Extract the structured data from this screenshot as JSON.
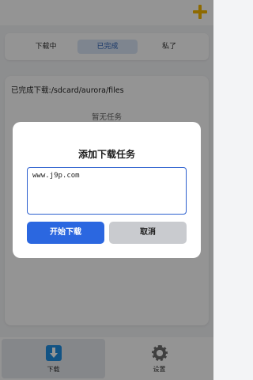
{
  "toolbar": {
    "add_icon": "plus-icon",
    "add_color": "#f5b700"
  },
  "tabs": [
    {
      "label": "下载中"
    },
    {
      "label": "已完成"
    },
    {
      "label": "私了"
    }
  ],
  "content": {
    "path_label": "已完成下载:/sdcard/aurora/files",
    "empty_label": "暂无任务"
  },
  "bottom_nav": [
    {
      "label": "下载",
      "icon": "download-icon"
    },
    {
      "label": "设置",
      "icon": "gear-icon"
    }
  ],
  "dialog": {
    "title": "添加下载任务",
    "url_value": "www.j9p.com",
    "start_label": "开始下载",
    "cancel_label": "取消",
    "accent": "#2b67e0"
  }
}
